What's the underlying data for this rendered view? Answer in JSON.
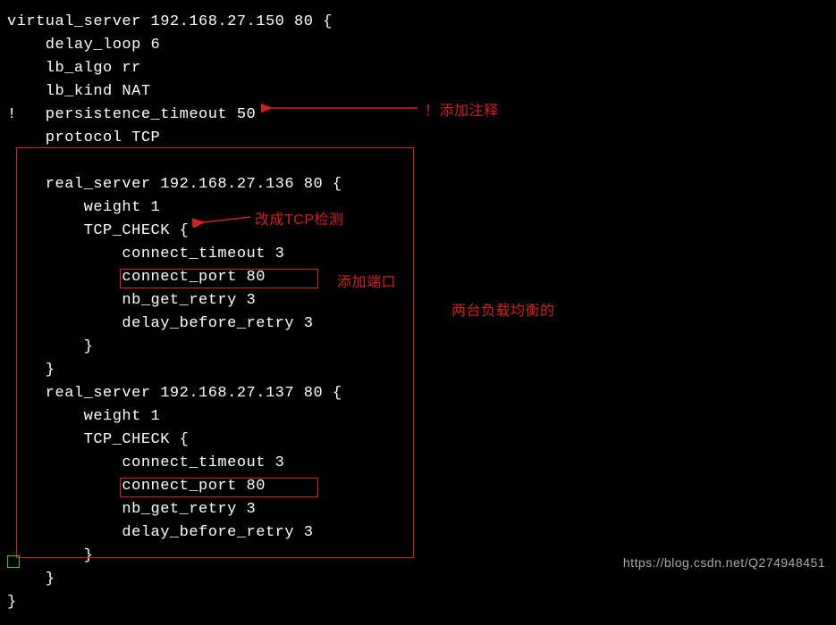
{
  "code": {
    "line1": "virtual_server 192.168.27.150 80 {",
    "line2": "    delay_loop 6",
    "line3": "    lb_algo rr",
    "line4": "    lb_kind NAT",
    "line5": "!   persistence_timeout 50",
    "line6": "    protocol TCP",
    "line7": "",
    "line8": "    real_server 192.168.27.136 80 {",
    "line9": "        weight 1",
    "line10": "        TCP_CHECK {",
    "line11": "            connect_timeout 3",
    "line12": "            connect_port 80",
    "line13": "            nb_get_retry 3",
    "line14": "            delay_before_retry 3",
    "line15": "        }",
    "line16": "    }",
    "line17": "    real_server 192.168.27.137 80 {",
    "line18": "        weight 1",
    "line19": "        TCP_CHECK {",
    "line20": "            connect_timeout 3",
    "line21": "            connect_port 80",
    "line22": "            nb_get_retry 3",
    "line23": "            delay_before_retry 3",
    "line24": "        }",
    "line25": "    }",
    "line26": "}"
  },
  "annotations": {
    "add_comment": "！添加注释",
    "change_tcp_check": "改成TCP检测",
    "add_port": "添加端口",
    "two_load_balanced": "两台负载均衡的"
  },
  "watermark": "https://blog.csdn.net/Q274948451"
}
